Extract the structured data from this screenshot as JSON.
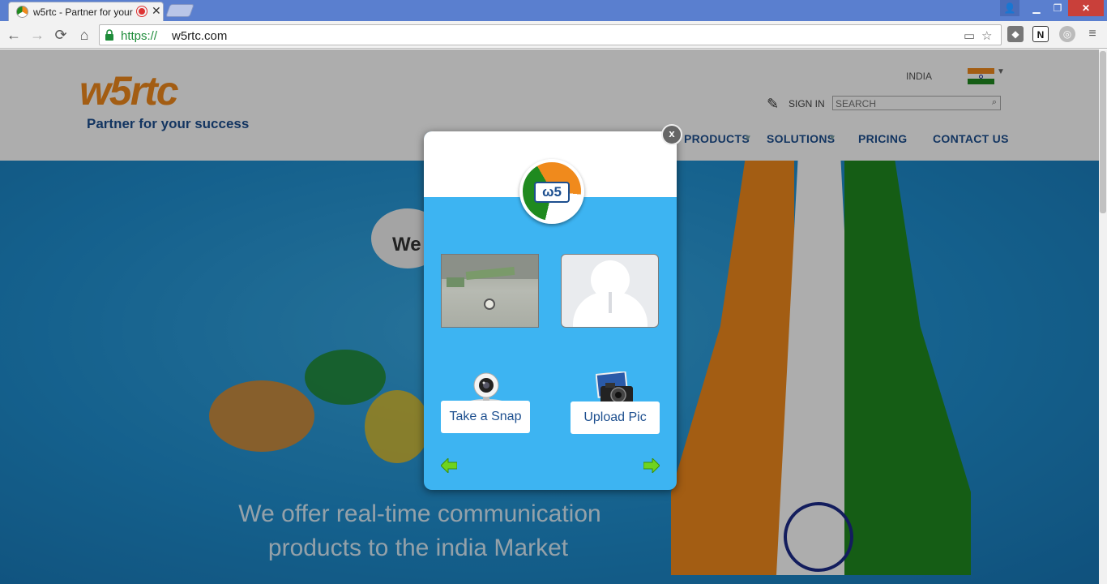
{
  "browser": {
    "tab_title": "w5rtc - Partner for your",
    "url_scheme": "https://",
    "url_host": "w5rtc.com"
  },
  "site": {
    "logo_main": "w5rtc",
    "tagline": "Partner for your success",
    "country": "INDIA",
    "signin": "SIGN IN",
    "search_placeholder": "SEARCH",
    "nav": [
      "PRODUCTS",
      "SOLUTIONS",
      "PRICING",
      "CONTACT US"
    ],
    "hero_line1": "We offer real-time communication",
    "hero_line2": "products to the india Market",
    "cloud_text": "We"
  },
  "modal": {
    "close_label": "x",
    "logo_text": "ω5",
    "take_snap_label": "Take a Snap",
    "upload_pic_label": "Upload Pic"
  },
  "colors": {
    "saffron": "#f08a1c",
    "green": "#1f8a1f",
    "brand_blue": "#1d4f8f",
    "modal_blue": "#3db4f2",
    "arrow_green": "#6fd31e"
  },
  "icons": {
    "take_snap": "webcam-icon",
    "upload_pic": "camera-icon",
    "prev": "arrow-left-icon",
    "next": "arrow-right-icon"
  }
}
